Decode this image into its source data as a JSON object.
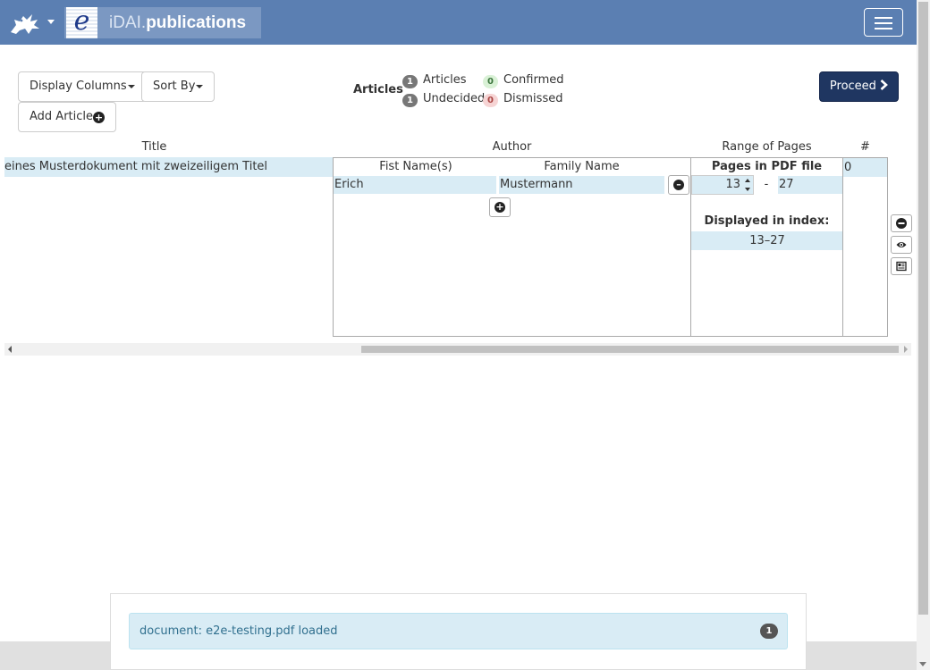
{
  "navbar": {
    "brand_light": "iDAI.",
    "brand_bold": "publications",
    "brand_e": "e",
    "menu_icon": "hamburger-icon",
    "logo_icon": "griffin-logo",
    "bg_color": "#5b7fb2"
  },
  "toolbar": {
    "display_columns": "Display Columns",
    "sort_by": "Sort By",
    "add_article": "Add Article",
    "proceed": "Proceed",
    "proceed_icon": "chevron-right-icon"
  },
  "summary": {
    "title": "Articles",
    "items": [
      {
        "count": "1",
        "label": "Articles",
        "color": "gray"
      },
      {
        "count": "0",
        "label": "Confirmed",
        "color": "green"
      },
      {
        "count": "1",
        "label": "Undecided",
        "color": "gray"
      },
      {
        "count": "0",
        "label": "Dismissed",
        "color": "red"
      }
    ]
  },
  "table": {
    "headers": {
      "title": "Title",
      "author": "Author",
      "range": "Range of Pages",
      "number": "#"
    },
    "row": {
      "title": "eines Musterdokument mit zweizeiligem Titel",
      "author_headers": {
        "first": "Fist Name(s)",
        "family": "Family Name"
      },
      "author": {
        "first": "Erich",
        "family": "Mustermann"
      },
      "pages_pdf_label": "Pages in PDF file",
      "page_from": "13",
      "page_sep": "-",
      "page_to": "27",
      "displayed_label": "Displayed in index:",
      "displayed_value": "13–27",
      "number": "0"
    },
    "row_actions": [
      "minus-circle-icon",
      "eye-icon",
      "newspaper-icon"
    ]
  },
  "message": {
    "text": "document: e2e-testing.pdf loaded",
    "count": "1"
  }
}
